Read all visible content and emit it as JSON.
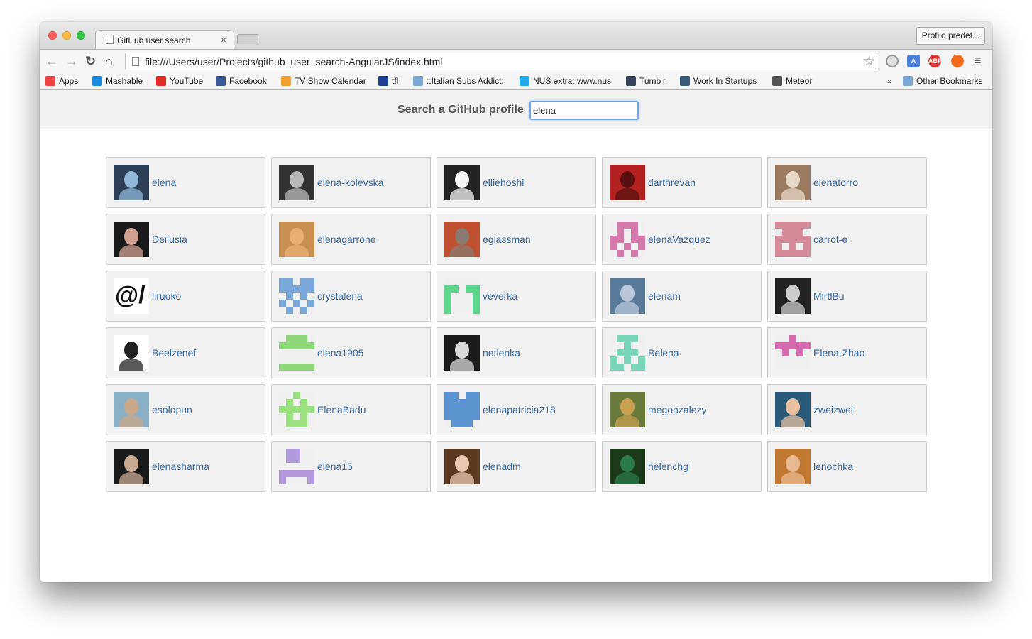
{
  "browser": {
    "tab_title": "GitHub user search",
    "tab_close": "×",
    "profile_button": "Profilo predef...",
    "url": "file:///Users/user/Projects/github_user_search-AngularJS/index.html",
    "bookmarks": [
      {
        "label": "Apps",
        "color": "#e44"
      },
      {
        "label": "Mashable",
        "color": "#1a8ae0"
      },
      {
        "label": "YouTube",
        "color": "#e52d27"
      },
      {
        "label": "Facebook",
        "color": "#3b5998"
      },
      {
        "label": "TV Show Calendar",
        "color": "#f0a030"
      },
      {
        "label": "tfl",
        "color": "#1c3f94"
      },
      {
        "label": "::Italian Subs Addict::",
        "color": "#7aa9d8"
      },
      {
        "label": "NUS extra: www.nus",
        "color": "#22aaee"
      },
      {
        "label": "Tumblr",
        "color": "#35465c"
      },
      {
        "label": "Work In Startups",
        "color": "#3a5a7a"
      },
      {
        "label": "Meteor",
        "color": "#555555"
      }
    ],
    "bookmarks_overflow": "»",
    "other_bookmarks": "Other Bookmarks"
  },
  "search": {
    "label": "Search a GitHub profile",
    "value": "elena"
  },
  "users": [
    {
      "login": "elena",
      "avatar_colors": [
        "#2c3e55",
        "#8fb8d8"
      ]
    },
    {
      "login": "elena-kolevska",
      "avatar_colors": [
        "#333333",
        "#b8b8b8"
      ]
    },
    {
      "login": "elliehoshi",
      "avatar_colors": [
        "#222222",
        "#f4f4f4"
      ]
    },
    {
      "login": "darthrevan",
      "avatar_colors": [
        "#b52222",
        "#5a1010"
      ]
    },
    {
      "login": "elenatorro",
      "avatar_colors": [
        "#9a7a60",
        "#e8d8c8"
      ]
    },
    {
      "login": "Deilusia",
      "avatar_colors": [
        "#1a1a1a",
        "#d0a090"
      ]
    },
    {
      "login": "elenagarrone",
      "avatar_colors": [
        "#c89050",
        "#e8b070"
      ]
    },
    {
      "login": "eglassman",
      "avatar_colors": [
        "#c05030",
        "#8a7a70"
      ]
    },
    {
      "login": "elenaVazquez",
      "identicon": "#d57aab",
      "pattern": "0111001010110111010101010"
    },
    {
      "login": "carrot-e",
      "identicon": "#d58a9a",
      "pattern": "1111101110111111010111111"
    },
    {
      "login": "liruoko",
      "avatar_text": "@/"
    },
    {
      "login": "crystalena",
      "identicon": "#7aa7da",
      "pattern": "1101111111010101010101010"
    },
    {
      "login": "veverka",
      "identicon": "#5cd68a",
      "pattern": "0000011011100011000110001"
    },
    {
      "login": "elenam",
      "avatar_colors": [
        "#5a7a9a",
        "#b8c8d8"
      ]
    },
    {
      "login": "MirtlBu",
      "avatar_colors": [
        "#222222",
        "#cccccc"
      ]
    },
    {
      "login": "Beelzenef",
      "avatar_colors": [
        "#ffffff",
        "#222222"
      ]
    },
    {
      "login": "elena1905",
      "identicon": "#8ed67a",
      "pattern": "0111011111000000000011111"
    },
    {
      "login": "netlenka",
      "avatar_colors": [
        "#1a1a1a",
        "#d8d8d8"
      ]
    },
    {
      "login": "Belena",
      "identicon": "#7ad6b8",
      "pattern": "0111000100011101010111011"
    },
    {
      "login": "Elena-Zhao",
      "identicon": "#d56aae",
      "pattern": "0010011111010100000000000"
    },
    {
      "login": "esolopun",
      "avatar_colors": [
        "#8ab0c8",
        "#c8a888"
      ]
    },
    {
      "login": "ElenaBadu",
      "identicon": "#9ae080",
      "pattern": "0010001010111110101001110"
    },
    {
      "login": "elenapatricia218",
      "identicon": "#5a93d0",
      "pattern": "1101111111111111111101110"
    },
    {
      "login": "megonzalezy",
      "avatar_colors": [
        "#6a7a3a",
        "#c8a050"
      ]
    },
    {
      "login": "zweizwei",
      "avatar_colors": [
        "#2a5a7a",
        "#e8c0a0"
      ]
    },
    {
      "login": "elenasharma",
      "avatar_colors": [
        "#1a1a1a",
        "#c8a890"
      ]
    },
    {
      "login": "elena15",
      "identicon": "#b09adc",
      "pattern": "0110001100000001111110001"
    },
    {
      "login": "elenadm",
      "avatar_colors": [
        "#5a3a20",
        "#e8c8b0"
      ]
    },
    {
      "login": "helenchg",
      "avatar_colors": [
        "#1a3a1a",
        "#2a7a4a"
      ]
    },
    {
      "login": "lenochka",
      "avatar_colors": [
        "#c07830",
        "#e8b890"
      ]
    }
  ]
}
